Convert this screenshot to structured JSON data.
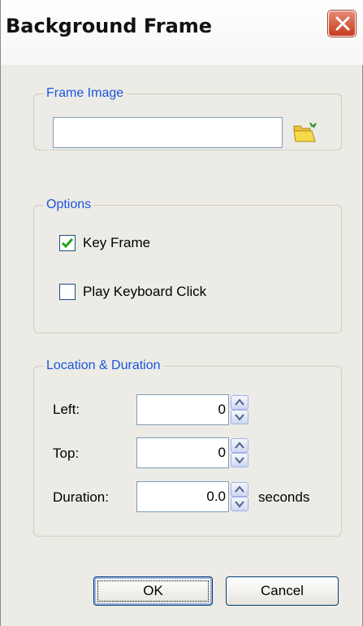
{
  "window": {
    "title": "Background Frame"
  },
  "frame_image": {
    "legend": "Frame Image",
    "path_value": "",
    "browse_icon": "folder-open-icon"
  },
  "options": {
    "legend": "Options",
    "key_frame": {
      "label": "Key Frame",
      "checked": true
    },
    "play_keyboard_click": {
      "label": "Play Keyboard Click",
      "checked": false
    }
  },
  "location": {
    "legend": "Location & Duration",
    "left": {
      "label": "Left:",
      "value": "0"
    },
    "top": {
      "label": "Top:",
      "value": "0"
    },
    "duration": {
      "label": "Duration:",
      "value": "0.0",
      "unit": "seconds"
    }
  },
  "buttons": {
    "ok": "OK",
    "cancel": "Cancel"
  },
  "colors": {
    "legend": "#1b55e0",
    "dialog_bg": "#ecebe5",
    "close": "#c63b1c"
  }
}
